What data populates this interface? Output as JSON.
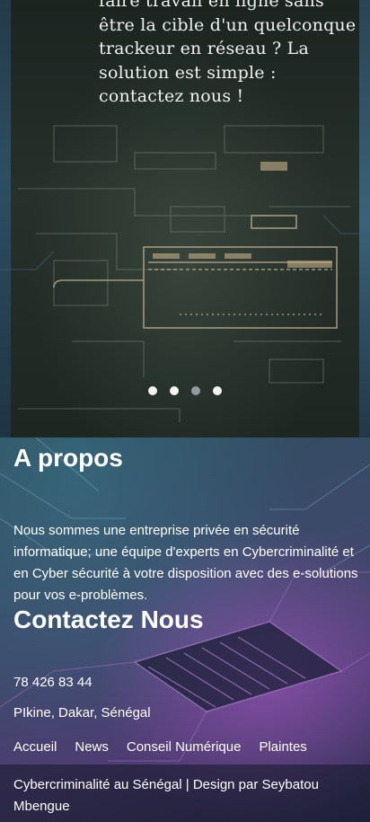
{
  "hero": {
    "slide_text": "faire travail en ligne sans être la cible d'un quelconque trackeur en réseau ? La solution est simple : contactez nous !",
    "dots": [
      {
        "active": false
      },
      {
        "active": false
      },
      {
        "active": true
      },
      {
        "active": false
      }
    ]
  },
  "about": {
    "title": "A propos",
    "text": "Nous sommes une entreprise privée en sécurité informatique; une équipe d'experts en Cybercriminalité et en Cyber sécurité à votre disposition avec des e-solutions pour vos e-problèmes."
  },
  "contact": {
    "title": "Contactez Nous",
    "phone": "78 426 83 44",
    "address": "PIkine, Dakar, Sénégal"
  },
  "nav": {
    "home": "Accueil",
    "news": "News",
    "advice": "Conseil Numérique",
    "complaints": "Plaintes"
  },
  "footer": {
    "text": "Cybercriminalité au Sénégal | Design par Seybatou Mbengue"
  }
}
